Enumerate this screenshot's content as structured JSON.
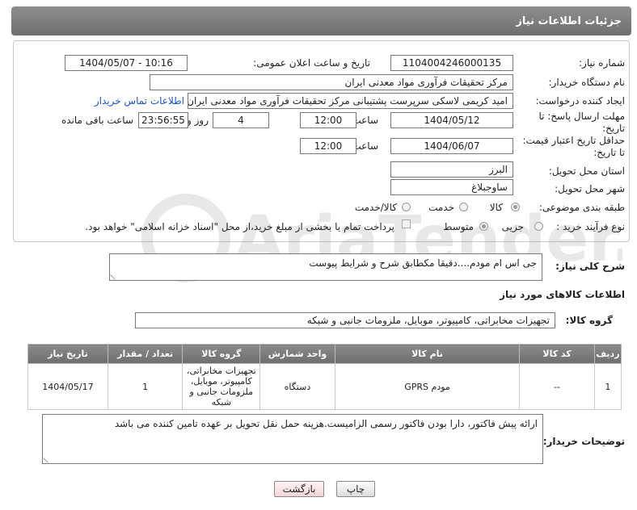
{
  "header": {
    "title": "جزئیات اطلاعات نیاز"
  },
  "fields": {
    "need_number_label": "شماره نیاز:",
    "need_number": "1104004246000135",
    "announce_label": "تاریخ و ساعت اعلان عمومی:",
    "announce_value": "1404/05/07 - 10:16",
    "buyer_org_label": "نام دستگاه خریدار:",
    "buyer_org": "مرکز تحقیقات فرآوری مواد معدنی ایران",
    "creator_label": "ایجاد کننده درخواست:",
    "creator": "امید کریمی لاسکی سرپرست پشتیبانی مرکز تحقیقات فرآوری مواد معدنی ایران",
    "contact_link": "اطلاعات تماس خریدار",
    "reply_deadline_label": "مهلت ارسال پاسخ: تا تاریخ:",
    "reply_date": "1404/05/12",
    "time_label": "ساعت",
    "reply_time": "12:00",
    "days_value": "4",
    "days_label": "روز و",
    "remaining_value": "23:56:55",
    "remaining_label": "ساعت باقی مانده",
    "min_validity_label": "حداقل تاریخ اعتبار قیمت: تا تاریخ:",
    "validity_date": "1404/06/07",
    "validity_time": "12:00",
    "province_label": "استان محل تحویل:",
    "province": "البرز",
    "city_label": "شهر محل تحویل:",
    "city": "ساوجبلاغ",
    "category_label": "طبقه بندی موضوعی:",
    "category_options": [
      "کالا",
      "خدمت",
      "کالا/خدمت"
    ],
    "process_label": "نوع فرآیند خرید :",
    "process_options": [
      "جزیی",
      "متوسط"
    ],
    "process_note": "پرداخت تمام یا بخشی از مبلغ خرید،از محل \"اسناد خزانه اسلامی\" خواهد بود."
  },
  "description": {
    "label": "شرح کلی نیاز:",
    "text": "جی اس ام مودم....دقیقا مکطابق شرح و شرایط پیوست"
  },
  "goods_section": {
    "title": "اطلاعات کالاهای مورد نیاز",
    "group_label": "گروه کالا:",
    "group_value": "تجهیزات مخابراتی، کامپیوتر، موبایل، ملزومات جانبی و شبکه"
  },
  "table": {
    "headers": [
      "ردیف",
      "کد کالا",
      "نام کالا",
      "واحد شمارش",
      "گروه کالا",
      "تعداد / مقدار",
      "تاریخ نیاز"
    ],
    "rows": [
      [
        "1",
        "--",
        "مودم GPRS",
        "دستگاه",
        "تجهیزات مخابراتی، کامپیوتر، موبایل، ملزومات جانبی و شبکه",
        "1",
        "1404/05/17"
      ]
    ]
  },
  "buyer_notes": {
    "label": "توضیحات خریدار:",
    "text": "ارائه پیش فاکتور، دارا بودن فاکتور رسمی الزامیست.هزینه حمل نقل تحویل بر عهده تامین کننده می باشد"
  },
  "buttons": {
    "print": "چاپ",
    "back": "بازگشت"
  },
  "watermark": {
    "text": "AriaTender.net"
  }
}
